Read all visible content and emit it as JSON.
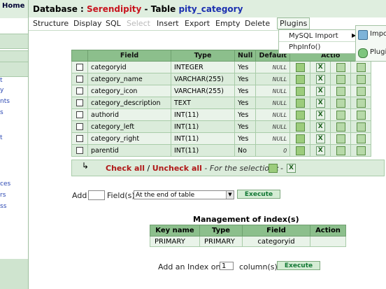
{
  "left": {
    "home": "Home",
    "links": [
      "t",
      "y",
      "nts",
      "s",
      "t",
      "ces",
      "rs",
      "ss"
    ]
  },
  "header": {
    "prefix": "Database : ",
    "db": "Serendipity",
    "mid": " - Table ",
    "table": "pity_category"
  },
  "menu": {
    "structure": "Structure",
    "display": "Display",
    "sql": "SQL",
    "select": "Select",
    "insert": "Insert",
    "export": "Export",
    "empty": "Empty",
    "delete": "Delete",
    "plugins": "Plugins"
  },
  "dropdown": {
    "mysql_import": "MySQL Import",
    "phpinfo": "PhpInfo()"
  },
  "submenu": {
    "import": "Impo",
    "plugins": "Plugi"
  },
  "structure_table": {
    "headers": [
      "Field",
      "Type",
      "Null",
      "Default",
      "Actio"
    ],
    "rows": [
      {
        "field": "categoryid",
        "type": "INTEGER",
        "null": "Yes",
        "default": "NULL"
      },
      {
        "field": "category_name",
        "type": "VARCHAR(255)",
        "null": "Yes",
        "default": "NULL"
      },
      {
        "field": "category_icon",
        "type": "VARCHAR(255)",
        "null": "Yes",
        "default": "NULL"
      },
      {
        "field": "category_description",
        "type": "TEXT",
        "null": "Yes",
        "default": "NULL"
      },
      {
        "field": "authorid",
        "type": "INT(11)",
        "null": "Yes",
        "default": "NULL"
      },
      {
        "field": "category_left",
        "type": "INT(11)",
        "null": "Yes",
        "default": "NULL"
      },
      {
        "field": "category_right",
        "type": "INT(11)",
        "null": "Yes",
        "default": "NULL"
      },
      {
        "field": "parentid",
        "type": "INT(11)",
        "null": "No",
        "default": "0"
      }
    ]
  },
  "selection": {
    "check_all": "Check all",
    "sep": " / ",
    "uncheck_all": "Uncheck all",
    "for_selection": " - For the selection :",
    "dash": "-"
  },
  "add_field": {
    "add": "Add",
    "fields": "Field(s)",
    "position": "At the end of table",
    "execute": "Execute"
  },
  "index": {
    "title": "Management of index(s)",
    "headers": [
      "Key name",
      "Type",
      "Field",
      "Action"
    ],
    "rows": [
      {
        "key": "PRIMARY",
        "type": "PRIMARY",
        "field": "categoryid"
      }
    ]
  },
  "add_index": {
    "prefix": "Add an Index on",
    "count": "1",
    "suffix": "column(s)",
    "execute": "Execute"
  },
  "colors": {
    "header_green": "#8cbf8c",
    "row_light": "#e9f3e9",
    "row_dark": "#dbecdb",
    "link_red": "#b01818",
    "title_blue": "#1a2fb0"
  }
}
